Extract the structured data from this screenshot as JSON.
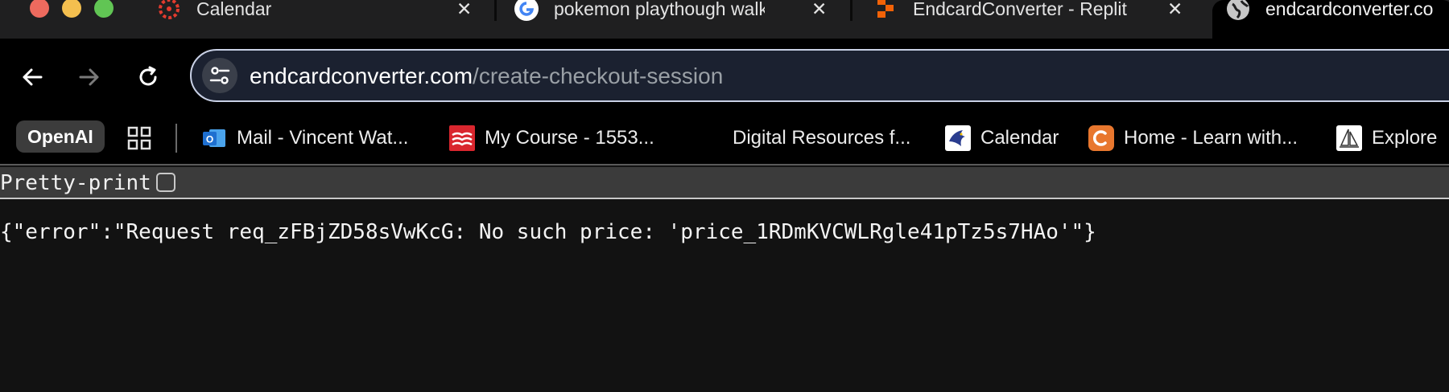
{
  "tabs": [
    {
      "title": "Calendar",
      "favicon": "canvas-logo-icon",
      "close": "✕"
    },
    {
      "title": "pokemon playthough walkt",
      "favicon": "google-g-icon",
      "close": "✕"
    },
    {
      "title": "EndcardConverter - Replit",
      "favicon": "replit-logo-icon",
      "close": "✕"
    },
    {
      "title": "endcardconverter.co",
      "favicon": "globe-icon",
      "active": true
    }
  ],
  "toolbar": {
    "back_icon": "arrow-left-icon",
    "forward_icon": "arrow-right-icon",
    "reload_icon": "reload-icon",
    "site_info_icon": "tune-icon",
    "url_domain": "endcardconverter.com",
    "url_path": "/create-checkout-session"
  },
  "bookmarks": [
    {
      "label": "OpenAI"
    },
    {
      "label": "Mail - Vincent Wat...",
      "icon": "outlook-icon"
    },
    {
      "label": "My Course - 1553...",
      "icon": "course-icon"
    },
    {
      "label": "Digital Resources f..."
    },
    {
      "label": "Calendar",
      "icon": "eagle-icon"
    },
    {
      "label": "Home - Learn with...",
      "icon": "c-logo-icon"
    },
    {
      "label": "Explore",
      "icon": "sail-icon"
    }
  ],
  "viewer": {
    "pretty_print_label": "Pretty-print",
    "pretty_print_checked": false,
    "json_text": "{\"error\":\"Request req_zFBjZD58sVwKcG: No such price: 'price_1RDmKVCWLRgle41pTz5s7HAo'\"}"
  },
  "colors": {
    "accent_blue": "#c9d1e6",
    "page_bg": "#121212",
    "outlook_blue": "#1e6fd0",
    "replit_orange": "#f26207",
    "canvas_red": "#e23b2e"
  }
}
